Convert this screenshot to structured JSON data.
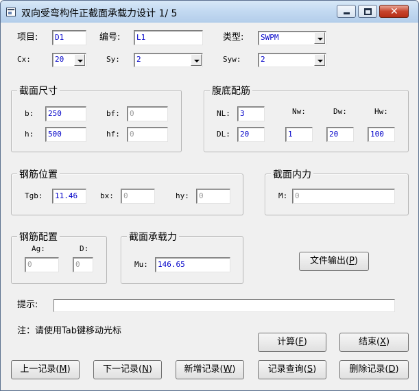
{
  "window": {
    "title": "双向受弯构件正截面承载力设计 1/ 5"
  },
  "top": {
    "project_label": "项目:",
    "project_value": "D1",
    "number_label": "编号:",
    "number_value": "L1",
    "type_label": "类型:",
    "type_value": "SWPM",
    "cx_label": "Cx:",
    "cx_value": "20",
    "sy_label": "Sy:",
    "sy_value": "2",
    "syw_label": "Syw:",
    "syw_value": "2"
  },
  "section": {
    "title": "截面尺寸",
    "b_label": "b:",
    "b_value": "250",
    "bf_label": "bf:",
    "bf_value": "0",
    "h_label": "h:",
    "h_value": "500",
    "hf_label": "hf:",
    "hf_value": "0"
  },
  "web": {
    "title": "腹底配筋",
    "nl_label": "NL:",
    "nl_value": "3",
    "nw_label": "Nw:",
    "dw_label": "Dw:",
    "hw_label": "Hw:",
    "dl_label": "DL:",
    "dl_value": "20",
    "nw_value": "1",
    "dw_value": "20",
    "hw_value": "100"
  },
  "rebar_pos": {
    "title": "钢筋位置",
    "tgb_label": "Tgb:",
    "tgb_value": "11.46",
    "bx_label": "bx:",
    "bx_value": "0",
    "hy_label": "hy:",
    "hy_value": "0"
  },
  "internal": {
    "title": "截面内力",
    "m_label": "M:",
    "m_value": "0"
  },
  "rebar_cfg": {
    "title": "钢筋配置",
    "ag_label": "Ag:",
    "ag_value": "0",
    "d_label": "D:",
    "d_value": "0"
  },
  "capacity": {
    "title": "截面承载力",
    "mu_label": "Mu:",
    "mu_value": "146.65"
  },
  "buttons": {
    "file_output": {
      "text": "文件输出(",
      "key": "P",
      "end": ")"
    },
    "calc": {
      "text": "计算(",
      "key": "F",
      "end": ")"
    },
    "finish": {
      "text": "结束(",
      "key": "X",
      "end": ")"
    },
    "prev": {
      "text": "上一记录(",
      "key": "M",
      "end": ")"
    },
    "next": {
      "text": "下一记录(",
      "key": "N",
      "end": ")"
    },
    "add": {
      "text": "新增记录(",
      "key": "W",
      "end": ")"
    },
    "query": {
      "text": "记录查询(",
      "key": "S",
      "end": ")"
    },
    "delete": {
      "text": "删除记录(",
      "key": "D",
      "end": ")"
    }
  },
  "hint": {
    "label": "提示:",
    "value": ""
  },
  "note": "注：请使用Tab键移动光标"
}
